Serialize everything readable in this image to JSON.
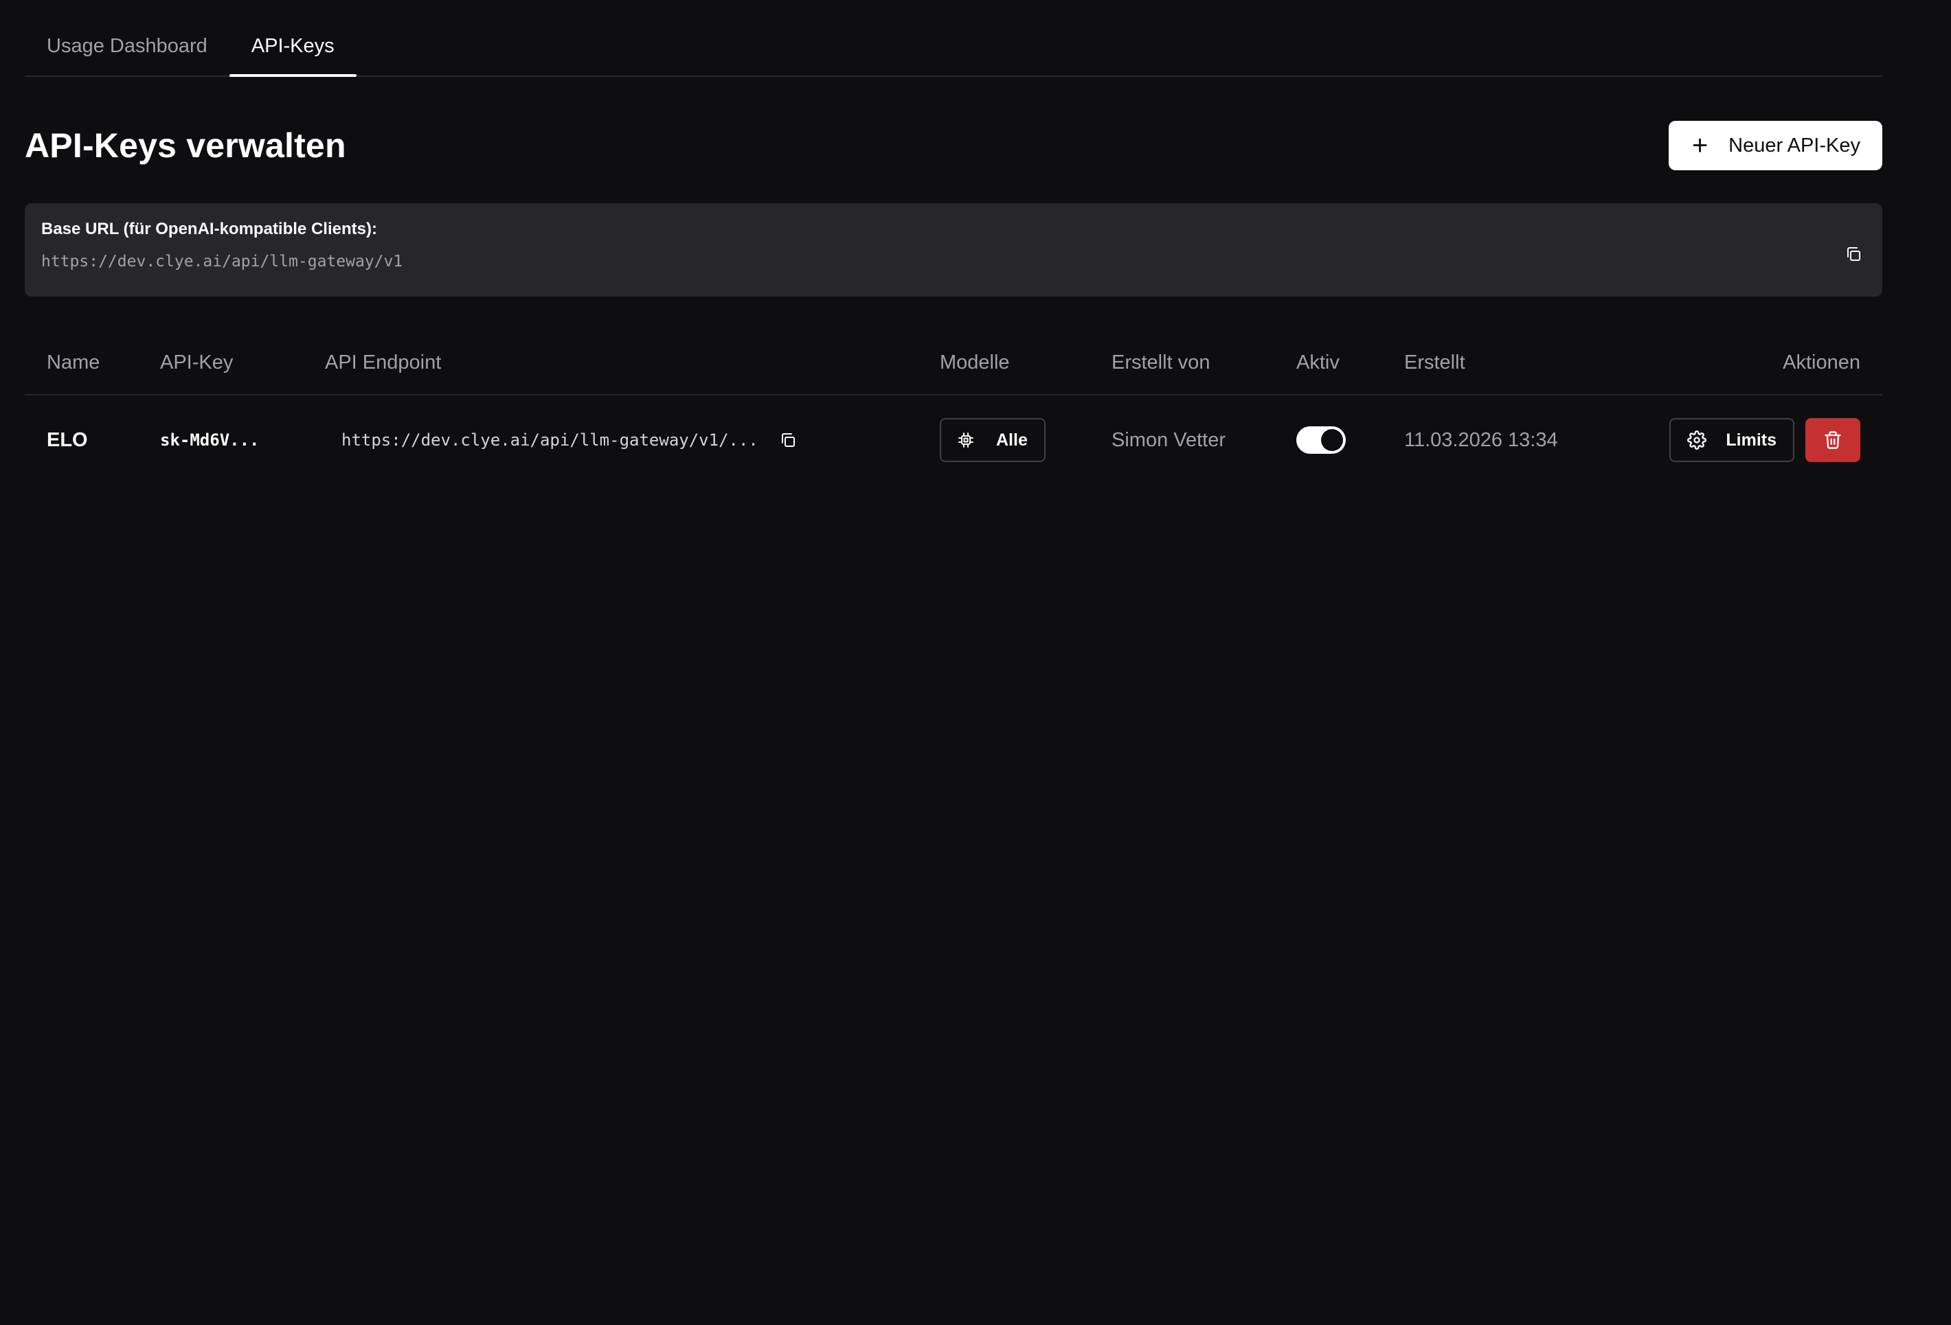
{
  "tabs": [
    {
      "label": "Usage Dashboard",
      "active": false
    },
    {
      "label": "API-Keys",
      "active": true
    }
  ],
  "header": {
    "title": "API-Keys verwalten",
    "new_key_label": "Neuer API-Key"
  },
  "base_url": {
    "label": "Base URL (für OpenAI-kompatible Clients):",
    "value": "https://dev.clye.ai/api/llm-gateway/v1"
  },
  "table": {
    "columns": {
      "name": "Name",
      "api_key": "API-Key",
      "endpoint": "API Endpoint",
      "models": "Modelle",
      "created_by": "Erstellt von",
      "active": "Aktiv",
      "created": "Erstellt",
      "actions": "Aktionen"
    },
    "rows": [
      {
        "name": "ELO",
        "api_key": "sk-Md6V...",
        "endpoint": "https://dev.clye.ai/api/llm-gateway/v1/...",
        "models": "Alle",
        "created_by": "Simon Vetter",
        "active": true,
        "created": "11.03.2026 13:34",
        "limits_label": "Limits"
      }
    ]
  },
  "colors": {
    "background": "#0e0e10",
    "panel": "#27272a",
    "border": "#3f3f46",
    "muted_text": "#a1a1aa",
    "danger": "#c53030"
  },
  "icons": [
    "plus-icon",
    "copy-icon",
    "chip-icon",
    "gear-icon",
    "trash-icon"
  ]
}
